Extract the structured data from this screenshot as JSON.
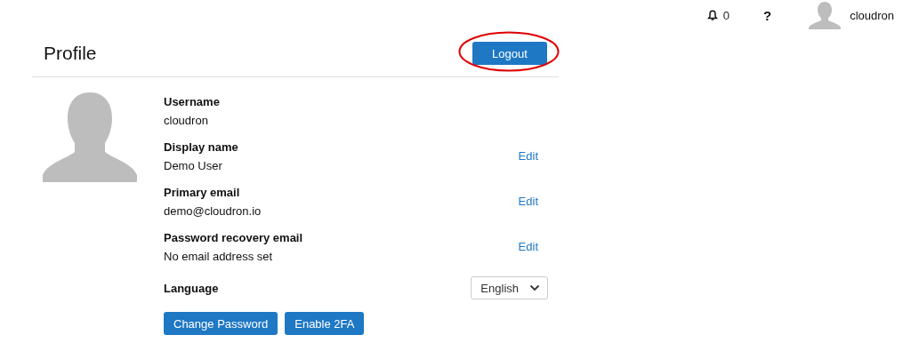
{
  "top_bar": {
    "notification_count": "0",
    "help": "?",
    "user": "cloudron"
  },
  "profile": {
    "title": "Profile",
    "logout": "Logout",
    "fields": [
      {
        "label": "Username",
        "value": "cloudron"
      },
      {
        "label": "Display name",
        "value": "Demo User",
        "edit": "Edit"
      },
      {
        "label": "Primary email",
        "value": "demo@cloudron.io",
        "edit": "Edit"
      },
      {
        "label": "Password recovery email",
        "value": "No email address set",
        "edit": "Edit"
      }
    ],
    "language": {
      "label": "Language",
      "value": "English"
    },
    "buttons": [
      "Change Password",
      "Enable 2FA"
    ]
  }
}
